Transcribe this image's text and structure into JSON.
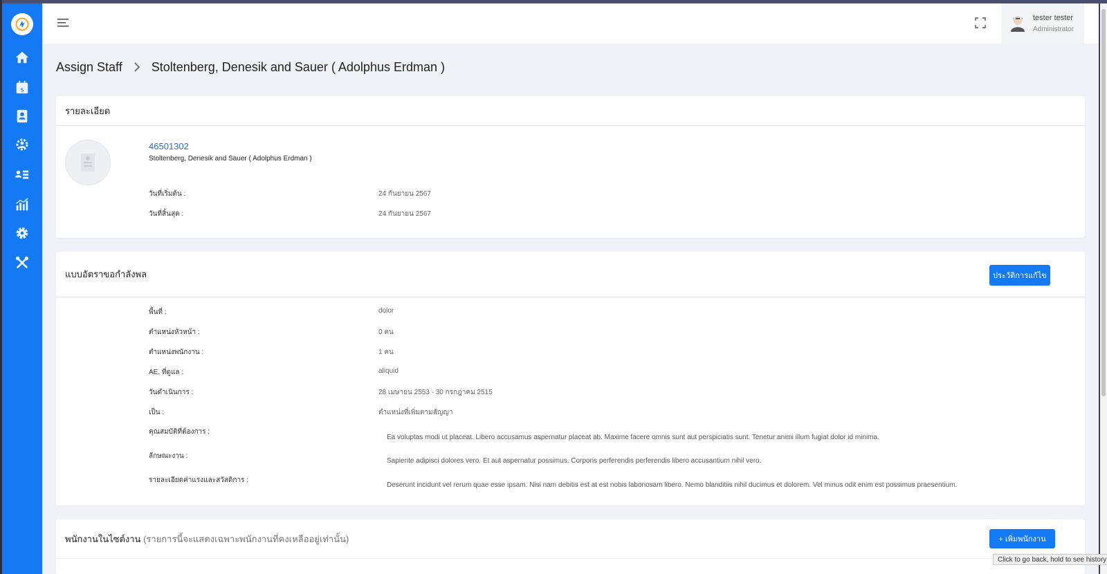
{
  "header": {
    "user_name": "tester tester",
    "user_role": "Administrator"
  },
  "sidebar": {
    "items": [
      {
        "icon": "home-icon"
      },
      {
        "icon": "calendar-dollar-icon"
      },
      {
        "icon": "contact-book-icon"
      },
      {
        "icon": "team-gear-icon"
      },
      {
        "icon": "staff-list-icon"
      },
      {
        "icon": "chart-icon"
      },
      {
        "icon": "settings-icon"
      },
      {
        "icon": "tools-icon"
      }
    ]
  },
  "breadcrumb": {
    "root": "Assign Staff",
    "current": "Stoltenberg, Denesik and Sauer ( Adolphus Erdman )"
  },
  "details": {
    "title": "รายละเอียด",
    "code": "46501302",
    "company": "Stoltenberg, Denesik and Sauer ( Adolphus Erdman )",
    "start_label": "วันที่เริ่มต้น :",
    "start_value": "24 กันยายน 2567",
    "end_label": "วันที่สิ้นสุด :",
    "end_value": "24 กันยายน 2567"
  },
  "staffing": {
    "title": "แบบอัตราขอกำลังพล",
    "history_button": "ประวัติการแก้ไข",
    "fields": [
      {
        "label": "พื้นที่ :",
        "value": "dolor"
      },
      {
        "label": "ตำแหน่งหัวหน้า :",
        "value": "0 คน"
      },
      {
        "label": "ตำแหน่งพนักงาน :",
        "value": "1 คน"
      },
      {
        "label": "AE. ที่ดูแล :",
        "value": "aliquid"
      },
      {
        "label": "วันดำเนินการ :",
        "value": "28 เมษายน 2553 - 30 กรกฎาคม 2515"
      },
      {
        "label": "เป็น :",
        "value": "ตำแหน่งที่เพิ่มตามสัญญา"
      }
    ],
    "qualifications_label": "คุณสมบัติที่ต้องการ :",
    "qualifications_value": "Ea voluptas modi ut placeat. Libero accusamus aspernatur placeat ab. Maxime facere omnis sunt aut perspiciatis sunt. Tenetur animi illum fugiat dolor id minima.",
    "job_label": "ลักษณะงาน :",
    "job_value": "Sapiente adipisci dolores vero. Et aut aspernatur possimus. Corporis perferendis perferendis libero accusantium nihil vero.",
    "wage_label": "รายละเอียดค่าแรงและสวัสดิการ :",
    "wage_value": "Deserunt incidunt vel rerum quae esse ipsam. Nisi nam debitis est at est nobis laboriosam libero. Nemo blanditiis nihil ducimus et dolorem. Vel minus odit enim est possimus praesentium."
  },
  "site_staff": {
    "title": "พนักงานในไซต์งาน",
    "note": "(รายการนี้จะแสดงเฉพาะพนักงานที่คงเหลืออยู่เท่านั้น)",
    "add_button": "+ เพิ่มพนักงาน"
  },
  "tooltip": "Click to go back, hold to see history",
  "colors": {
    "primary": "#1479f4",
    "link": "#2f6fd6",
    "background": "#f1f2f7"
  }
}
